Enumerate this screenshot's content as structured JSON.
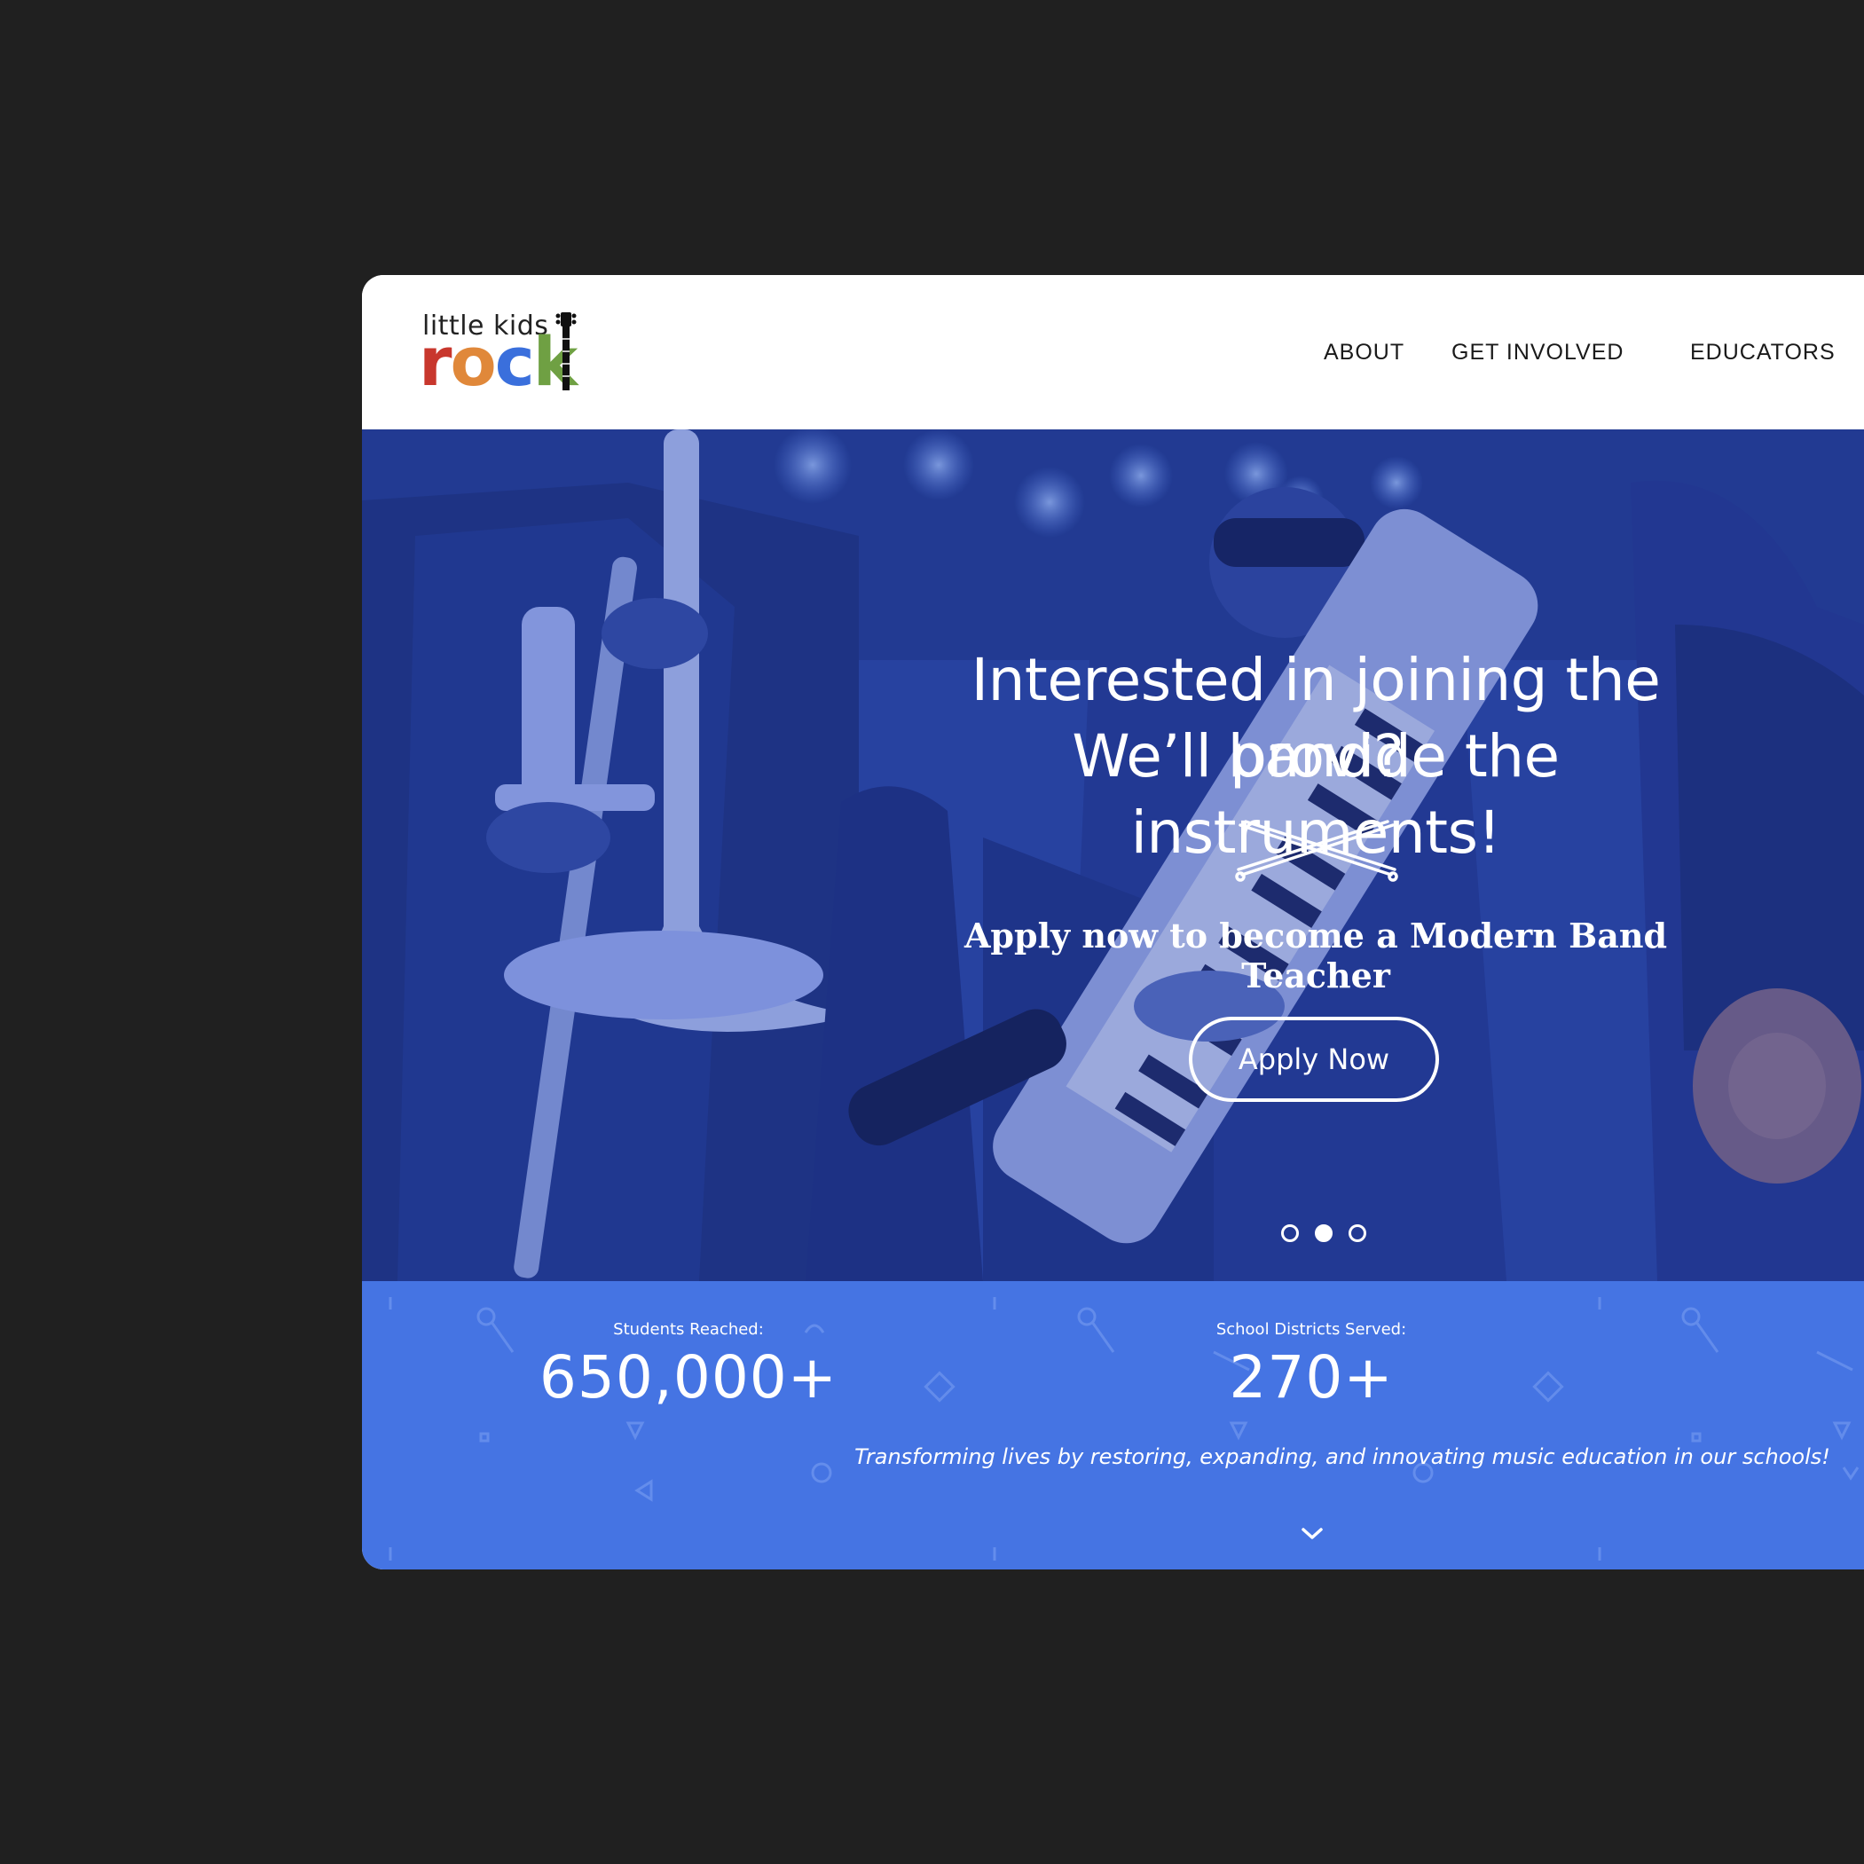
{
  "logo": {
    "line1": "little kids",
    "letters": [
      {
        "char": "r",
        "color": "#c8372d"
      },
      {
        "char": "o",
        "color": "#e0883a"
      },
      {
        "char": "c",
        "color": "#3a6fdc"
      },
      {
        "char": "k",
        "color": "#6fa043"
      }
    ]
  },
  "nav": {
    "items": [
      "ABOUT",
      "GET INVOLVED",
      "EDUCATORS"
    ]
  },
  "hero": {
    "title_line1": "Interested in joining the band?",
    "title_line2": "We’ll provide the instruments!",
    "subtitle": "Apply now to become a Modern Band Teacher",
    "button_label": "Apply  Now",
    "carousel": {
      "count": 3,
      "active_index": 1
    }
  },
  "stats": {
    "items": [
      {
        "label": "Students Reached:",
        "value": "650,000+"
      },
      {
        "label": "School Districts Served:",
        "value": "270+"
      }
    ],
    "tagline": "Transforming lives by restoring, expanding, and innovating music education in our schools!"
  },
  "icons": {
    "drumsticks": "crossed-drumsticks-icon",
    "chevron": "chevron-down-icon",
    "guitar": "guitar-icon"
  },
  "colors": {
    "background": "#202020",
    "hero_overlay": "#263f9a",
    "stats_band": "#4574e3",
    "text_light": "#ffffff"
  }
}
